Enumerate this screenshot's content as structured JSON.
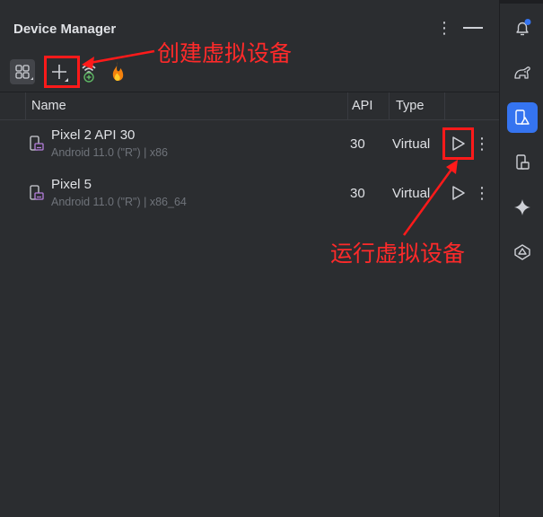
{
  "panel": {
    "title": "Device Manager",
    "more_icon": "vertical-ellipsis-icon",
    "minimize_icon": "minimize-icon"
  },
  "toolbar": [
    {
      "name": "layout-toggle-button",
      "icon": "grid-icon"
    },
    {
      "name": "create-device-button",
      "icon": "plus-icon"
    },
    {
      "name": "pair-wifi-button",
      "icon": "wifi-add-icon"
    },
    {
      "name": "firebase-button",
      "icon": "firebase-flame-icon"
    }
  ],
  "table": {
    "headers": {
      "name": "Name",
      "api": "API",
      "type": "Type"
    },
    "rows": [
      {
        "name": "Pixel 2 API 30",
        "details": "Android 11.0 (\"R\") | x86",
        "api": "30",
        "type": "Virtual",
        "icon": "phone-device-icon"
      },
      {
        "name": "Pixel 5",
        "details": "Android 11.0 (\"R\") | x86_64",
        "api": "30",
        "type": "Virtual",
        "icon": "phone-device-icon"
      }
    ]
  },
  "right_toolbar": [
    {
      "name": "notifications-icon",
      "badge": true
    },
    {
      "name": "gradle-elephant-icon"
    },
    {
      "name": "device-manager-icon",
      "active": true
    },
    {
      "name": "running-devices-icon"
    },
    {
      "name": "gemini-sparkle-icon"
    },
    {
      "name": "ai-assistant-icon"
    }
  ],
  "annotations": {
    "create": "创建虚拟设备",
    "run": "运行虚拟设备",
    "color": "#ff1a1a"
  },
  "colors": {
    "background": "#2b2d30",
    "accent": "#3574f0",
    "text": "#dfe1e5",
    "muted_text": "#6f737a",
    "device_icon": "#b57edc"
  }
}
